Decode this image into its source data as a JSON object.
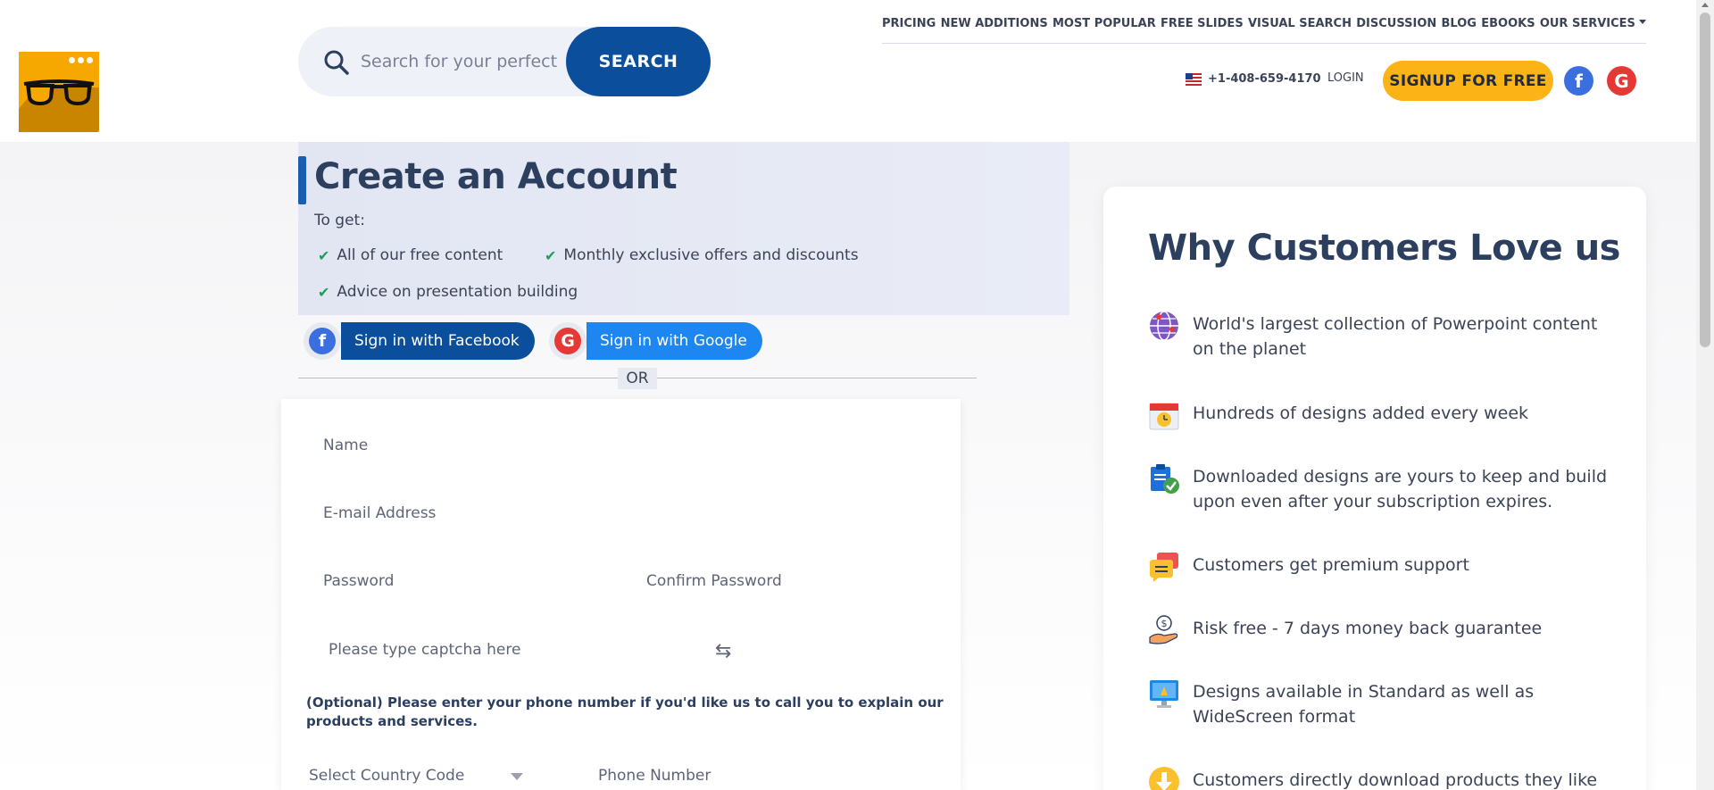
{
  "header": {
    "search_placeholder": "Search for your perfect presentation",
    "search_button": "SEARCH",
    "nav": [
      {
        "label": "PRICING"
      },
      {
        "label": "NEW ADDITIONS"
      },
      {
        "label": "MOST POPULAR"
      },
      {
        "label": "FREE SLIDES"
      },
      {
        "label": "VISUAL SEARCH"
      },
      {
        "label": "DISCUSSION"
      },
      {
        "label": "BLOG"
      },
      {
        "label": "EBOOKS"
      },
      {
        "label": "OUR SERVICES"
      }
    ],
    "phone": "+1-408-659-4170",
    "login": "LOGIN",
    "signup": "SIGNUP FOR FREE",
    "facebook_glyph": "f",
    "google_glyph": "G"
  },
  "intro": {
    "title": "Create an Account",
    "to_get": "To get:",
    "benefits": [
      "All of our free content",
      "Monthly exclusive offers and discounts",
      "Advice on presentation building"
    ]
  },
  "social": {
    "facebook_label": "Sign in with Facebook",
    "google_label": "Sign in with Google",
    "or": "OR"
  },
  "form": {
    "name_placeholder": "Name",
    "email_placeholder": "E-mail Address",
    "password_placeholder": "Password",
    "confirm_placeholder": "Confirm Password",
    "captcha_placeholder": "Please type captcha here",
    "optional_text": "(Optional) Please enter your phone number if you'd like us to call you to explain our products and services.",
    "country_code": "Select Country Code",
    "phone_placeholder": "Phone Number"
  },
  "panel": {
    "title": "Why Customers Love us",
    "features": [
      {
        "icon": "globe-icon",
        "text": "World's largest collection of Powerpoint content on the planet"
      },
      {
        "icon": "calendar-icon",
        "text": "Hundreds of designs added every week"
      },
      {
        "icon": "clipboard-check-icon",
        "text": "Downloaded designs are yours to keep and build upon even after your subscription expires."
      },
      {
        "icon": "chat-support-icon",
        "text": "Customers get premium support"
      },
      {
        "icon": "money-hand-icon",
        "text": "Risk free - 7 days money back guarantee"
      },
      {
        "icon": "monitor-icon",
        "text": "Designs available in Standard as well as WideScreen format"
      },
      {
        "icon": "download-icon",
        "text": "Customers directly download products they like"
      }
    ]
  },
  "colors": {
    "primary": "#0b4f9c",
    "accent": "#fbb316",
    "facebook": "#3b6fe0",
    "google": "#e53935",
    "check": "#1e9e5a"
  }
}
